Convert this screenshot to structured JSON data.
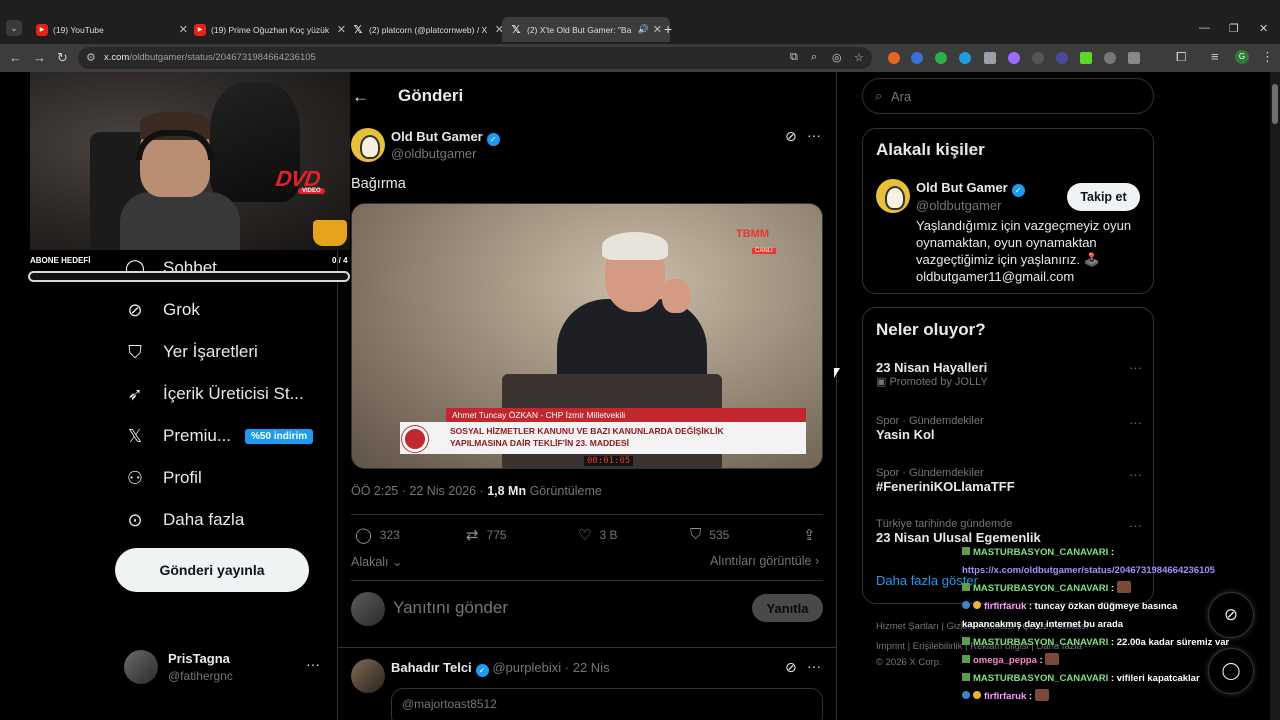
{
  "browser": {
    "tabs": [
      {
        "label": "(19) YouTube",
        "favicon": "youtube-icon"
      },
      {
        "label": "(19) Prime Oğuzhan Koç yüzük",
        "favicon": "youtube-icon"
      },
      {
        "label": "(2) platcorn (@platcornweb) / X",
        "favicon": "x-icon"
      },
      {
        "label": "(2) X'te Old But Gamer: \"Ba",
        "favicon": "x-icon",
        "active": true
      }
    ],
    "url_host": "x.com",
    "url_path": "/oldbutgamer/status/2046731984664236105",
    "profile_initial": "G"
  },
  "stream_overlay": {
    "goal_label": "ABONE HEDEFİ",
    "goal_count": "0 / 4",
    "goal_progress": 0,
    "dvd_text": "DVD",
    "dvd_sub": "VIDEO"
  },
  "nav": {
    "items": [
      {
        "label": "Sohbet",
        "icon": "chat-icon"
      },
      {
        "label": "Grok",
        "icon": "grok-icon"
      },
      {
        "label": "Yer İşaretleri",
        "icon": "bookmark-icon"
      },
      {
        "label": "İçerik Üreticisi St...",
        "icon": "rocket-icon"
      },
      {
        "label": "Premiu...",
        "icon": "x-logo-icon",
        "badge": "%50 indirim"
      },
      {
        "label": "Profil",
        "icon": "person-icon"
      },
      {
        "label": "Daha fazla",
        "icon": "more-circle-icon"
      }
    ],
    "post_button": "Gönderi yayınla",
    "account_name": "PrisTagna",
    "account_handle": "@fatihergnc"
  },
  "main": {
    "title": "Gönderi",
    "post": {
      "author": "Old But Gamer",
      "handle": "@oldbutgamer",
      "text": "Bağırma",
      "video": {
        "channel_logo": "TBMM",
        "channel_live": "CANLI",
        "speaker_caption": "Ahmet Tuncay ÖZKAN - CHP İzmir Milletvekili",
        "caption_line1": "SOSYAL HİZMETLER KANUNU VE BAZI KANUNLARDA DEĞİŞİKLİK",
        "caption_line2": "YAPILMASINA DAİR TEKLİF'İN 23. MADDESİ",
        "timecode": "00:01:05"
      },
      "time": "ÖÖ 2:25",
      "date": "22 Nis 2026",
      "views_count": "1,8 Mn",
      "views_label": "Görüntüleme",
      "replies": "323",
      "reposts": "775",
      "likes": "3 B",
      "bookmarks": "535",
      "related_label": "Alakalı",
      "quotes_label": "Alıntıları görüntüle"
    },
    "reply_placeholder": "Yanıtını gönder",
    "reply_button": "Yanıtla",
    "reply2": {
      "name": "Bahadır Telci",
      "handle": "@purplebixi",
      "date": "22 Nis",
      "quote_preview": "@majortoast8512"
    }
  },
  "sidebar": {
    "search_placeholder": "Ara",
    "relevant_title": "Alakalı kişiler",
    "relevant_person": {
      "name": "Old But Gamer",
      "handle": "@oldbutgamer",
      "follow_label": "Takip et",
      "bio": "Yaşlandığımız için vazgeçmeyiz oyun oynamaktan, oyun oynamaktan vazgeçtiğimiz için yaşlanırız. 🕹️ oldbutgamer11@gmail.com"
    },
    "trends_title": "Neler oluyor?",
    "trends": [
      {
        "category": "",
        "name": "23 Nisan Hayalleri",
        "promo": "Promoted by JOLLY"
      },
      {
        "category": "Spor · Gündemdekiler",
        "name": "Yasin Kol",
        "promo": ""
      },
      {
        "category": "Spor · Gündemdekiler",
        "name": "#FeneriniKOLlamaTFF",
        "promo": ""
      },
      {
        "category": "Türkiye tarihinde gündemde",
        "name": "23 Nisan Ulusal Egemenlik",
        "promo": ""
      }
    ],
    "show_more": "Daha fazla göster",
    "footer_line1": "Hizmet Şartları  |  Gizlilik Politikası  |  Çerez Politikası",
    "footer_line2": "Imprint  |  Erişilebilirlik  |  Reklam bilgisi  |  Daha fazla ···",
    "footer_line3": "© 2026 X Corp."
  },
  "chat": {
    "messages": [
      {
        "user": "MASTURBASYON_CANAVARI",
        "sep": " :",
        "text": "",
        "user_class": "u1"
      },
      {
        "user": "",
        "sep": "",
        "text": "https://x.com/oldbutgamer/status/2046731984664236105",
        "user_class": "link"
      },
      {
        "user": "MASTURBASYON_CANAVARI",
        "sep": " :",
        "text": "",
        "user_class": "u1",
        "emote": true
      },
      {
        "user": "firfirfaruk",
        "sep": " :",
        "text": " tuncay özkan düğmeye basınca",
        "user_class": "u2"
      },
      {
        "user": "",
        "sep": "",
        "text": "kapancakmış dayı internet bu arada",
        "user_class": ""
      },
      {
        "user": "MASTURBASYON_CANAVARI",
        "sep": " :",
        "text": " 22.00a kadar süremiz var",
        "user_class": "u1"
      },
      {
        "user": "omega_peppa",
        "sep": " :",
        "text": "",
        "user_class": "u3",
        "emote": true
      },
      {
        "user": "MASTURBASYON_CANAVARI",
        "sep": " :",
        "text": " vifileri kapatcaklar",
        "user_class": "u1"
      },
      {
        "user": "firfirfaruk",
        "sep": " :",
        "text": "",
        "user_class": "u2",
        "emote": true
      }
    ]
  }
}
